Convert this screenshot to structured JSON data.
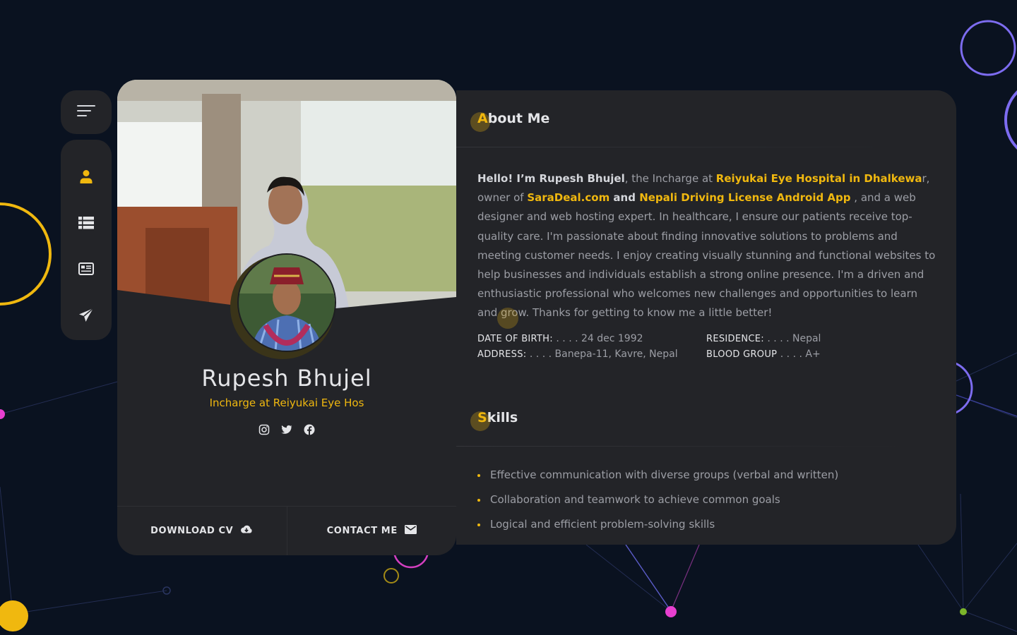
{
  "nav": {
    "items": [
      {
        "icon": "user-icon",
        "active": true
      },
      {
        "icon": "list-icon",
        "active": false
      },
      {
        "icon": "news-icon",
        "active": false
      },
      {
        "icon": "paper-plane-icon",
        "active": false
      }
    ]
  },
  "profile": {
    "name": "Rupesh Bhujel",
    "role": "Incharge at Reiyukai Eye Hos",
    "socials": [
      "instagram-icon",
      "twitter-icon",
      "facebook-icon"
    ],
    "download_label": "DOWNLOAD CV",
    "contact_label": "CONTACT ME"
  },
  "about": {
    "title_first": "A",
    "title_rest": "bout Me",
    "intro_greeting": "Hello! I’m Rupesh Bhujel",
    "intro_part1": ", the Incharge at ",
    "hospital": "Reiyukai Eye Hospital in Dhalkewa",
    "intro_part2": "r, owner of ",
    "saradeal": "SaraDeal.com",
    "and_word": " and ",
    "app": "Nepali Driving License Android App",
    "body": " , and a web designer and web hosting expert. In healthcare, I ensure our patients receive top-quality care.  I'm passionate about finding innovative solutions to problems and meeting customer needs. I enjoy creating visually stunning and functional websites to help businesses and individuals establish a strong online presence. I'm a driven and enthusiastic professional who welcomes new challenges and opportunities to learn and grow. Thanks for getting to know me a little better!",
    "info": [
      {
        "key": "DATE OF BIRTH:",
        "value": " . . . .  24 dec 1992"
      },
      {
        "key": "RESIDENCE:",
        "value": " . . . .  Nepal"
      },
      {
        "key": "ADDRESS:",
        "value": " . . . .  Banepa-11, Kavre, Nepal"
      },
      {
        "key": "BLOOD GROUP",
        "value": " . . . .  A+"
      }
    ]
  },
  "skills": {
    "title_first": "S",
    "title_rest": "kills",
    "items": [
      "Effective communication with diverse groups (verbal and written)",
      "Collaboration and teamwork to achieve common goals",
      "Logical and efficient problem-solving skills"
    ]
  },
  "colors": {
    "accent": "#f0b80f",
    "background": "#0a1220",
    "panel": "#232428",
    "decor_magenta": "#e83fd0",
    "decor_violet": "#7d6cf0",
    "decor_green": "#7bb52a"
  }
}
